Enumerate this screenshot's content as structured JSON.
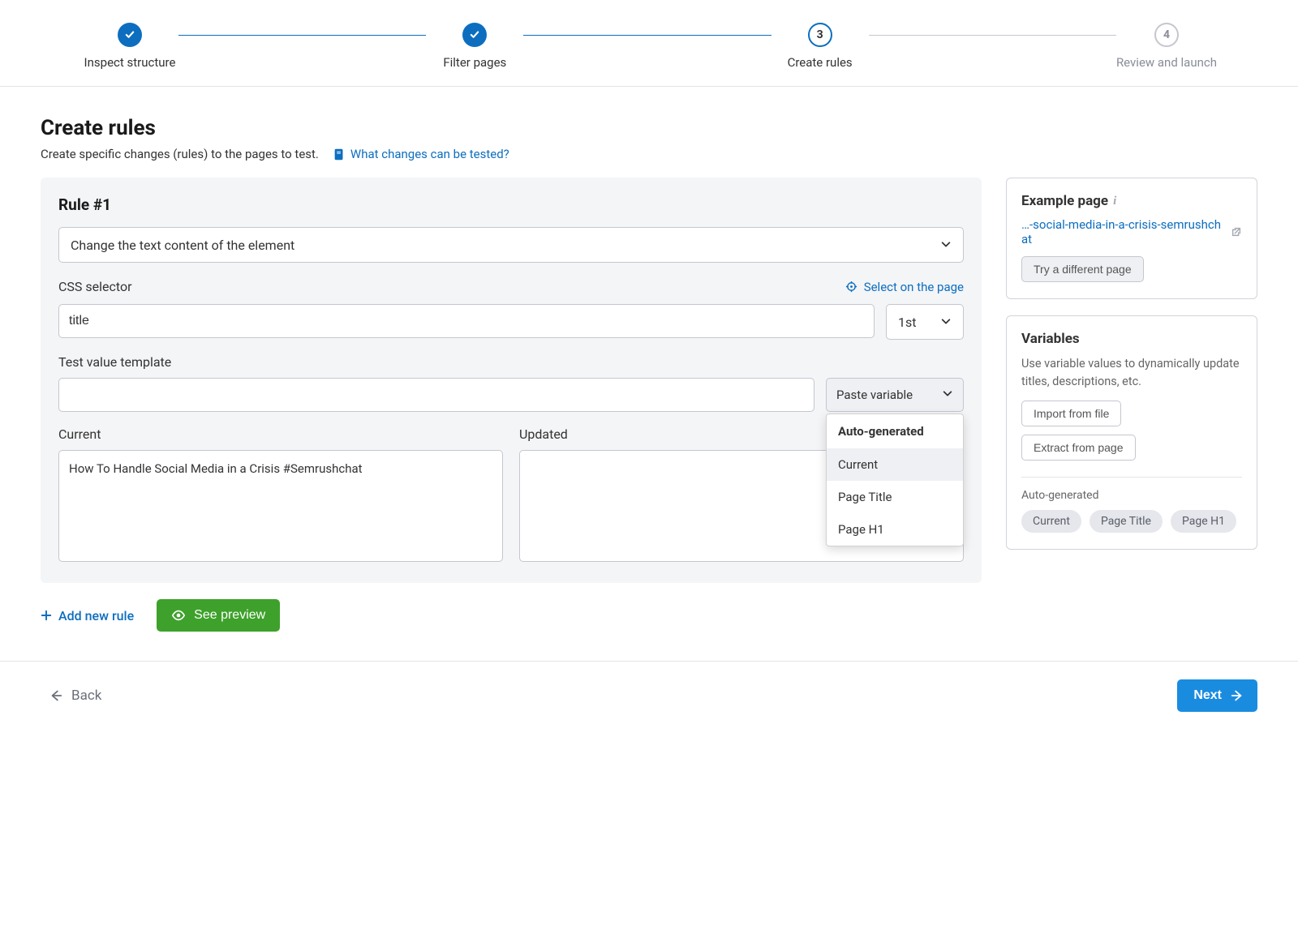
{
  "stepper": {
    "steps": [
      {
        "label": "Inspect structure",
        "state": "done"
      },
      {
        "label": "Filter pages",
        "state": "done"
      },
      {
        "label": "Create rules",
        "state": "current",
        "num": "3"
      },
      {
        "label": "Review and launch",
        "state": "future",
        "num": "4"
      }
    ]
  },
  "page": {
    "title": "Create rules",
    "subtitle": "Create specific changes (rules) to the pages to test.",
    "help_link": "What changes can be tested?"
  },
  "rule": {
    "title": "Rule #1",
    "action_select": "Change the text content of the element",
    "css_label": "CSS selector",
    "select_on_page": "Select on the page",
    "css_value": "title",
    "ordinal": "1st",
    "template_label": "Test value template",
    "template_value": "",
    "paste_label": "Paste variable",
    "dropdown": {
      "head": "Auto-generated",
      "items": [
        "Current",
        "Page Title",
        "Page H1"
      ],
      "hover_index": 0
    },
    "current_label": "Current",
    "updated_label": "Updated",
    "current_value": "How To Handle Social Media in a Crisis #Semrushchat",
    "updated_value": ""
  },
  "actions": {
    "add_rule": "Add new rule",
    "preview": "See preview"
  },
  "example": {
    "heading": "Example page",
    "url_text": "…-social-media-in-a-crisis-semrushchat",
    "try_btn": "Try a different page"
  },
  "variables": {
    "heading": "Variables",
    "desc": "Use variable values to dynamically update titles, descriptions, etc.",
    "import_btn": "Import from file",
    "extract_btn": "Extract from page",
    "auto_head": "Auto-generated",
    "tags": [
      "Current",
      "Page Title",
      "Page H1"
    ]
  },
  "footer": {
    "back": "Back",
    "next": "Next"
  }
}
